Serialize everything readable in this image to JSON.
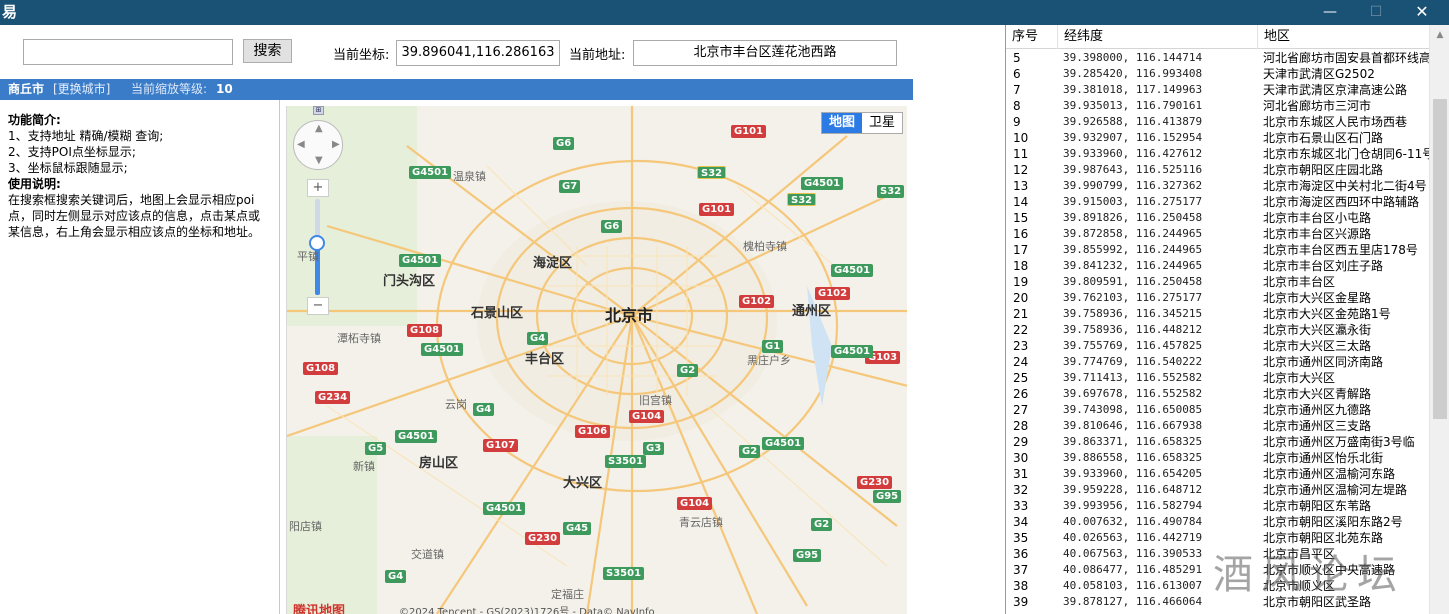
{
  "window": {
    "icon": "app-icon",
    "title": "",
    "controls": {
      "minimize": "—",
      "maximize": "☐",
      "close": "✕"
    }
  },
  "toolbar": {
    "search_value": "",
    "search_button": "搜索",
    "coord_label": "当前坐标:",
    "coord_value": "39.896041,116.286163",
    "address_label": "当前地址:",
    "address_value": "北京市丰台区莲花池西路"
  },
  "city_bar": {
    "city_name": "商丘市",
    "change_city": "[更换城市]",
    "zoom_label": "当前缩放等级:",
    "zoom_value": "10"
  },
  "info": {
    "features_title": "功能简介:",
    "features": [
      "1、支持地址 精确/模糊 查询;",
      "2、支持POI点坐标显示;",
      "3、坐标鼠标跟随显示;"
    ],
    "usage_title": "使用说明:",
    "usage_text": "在搜索框搜索关键词后，地图上会显示相应poi点，同时左侧显示对应该点的信息，点击某点或某信息，右上角会显示相应该点的坐标和地址。"
  },
  "map": {
    "map_type_buttons": [
      "地图",
      "卫星"
    ],
    "selected_type": "地图",
    "zoom_in": "+",
    "zoom_out": "−",
    "zoom_level_fraction": 0.45,
    "logo": "腾讯地图",
    "copyright": "©2024 Tencent - GS(2023)1726号 - Data© NavInfo",
    "city_label": "北京市",
    "districts": [
      "海淀区",
      "门头沟区",
      "石景山区",
      "丰台区",
      "通州区",
      "房山区",
      "大兴区"
    ],
    "towns": [
      "温泉镇",
      "槐柏寺镇",
      "潭柘寺镇",
      "云岗",
      "黑庄户乡",
      "旧宫镇",
      "新镇",
      "交道镇",
      "青云店镇",
      "定福庄",
      "平镇",
      "阳店镇"
    ],
    "shields": [
      "G6",
      "G7",
      "G6",
      "S32",
      "G4501",
      "G101",
      "G4501",
      "S32",
      "G4501",
      "G102",
      "G102",
      "G4501",
      "G103",
      "G108",
      "G4501",
      "G4",
      "G1",
      "G2",
      "G4501",
      "G4",
      "G107",
      "G106",
      "G104",
      "G3",
      "S3501",
      "G4501",
      "G2",
      "G4501",
      "G104",
      "G230",
      "G95",
      "G45",
      "G230",
      "G2",
      "S3501",
      "G95",
      "G4",
      "G5",
      "G108",
      "G234",
      "G101",
      "S32",
      "G4501"
    ]
  },
  "grid": {
    "headers": {
      "no": "序号",
      "coord": "经纬度",
      "region": "地区"
    },
    "rows": [
      {
        "no": "5",
        "coord": "39.398000, 116.144714",
        "region": "河北省廊坊市固安县首都环线高"
      },
      {
        "no": "6",
        "coord": "39.285420, 116.993408",
        "region": "天津市武清区G2502"
      },
      {
        "no": "7",
        "coord": "39.381018, 117.149963",
        "region": "天津市武清区京津高速公路"
      },
      {
        "no": "8",
        "coord": "39.935013, 116.790161",
        "region": "河北省廊坊市三河市"
      },
      {
        "no": "9",
        "coord": "39.926588, 116.413879",
        "region": "北京市东城区人民市场西巷"
      },
      {
        "no": "10",
        "coord": "39.932907, 116.152954",
        "region": "北京市石景山区石门路"
      },
      {
        "no": "11",
        "coord": "39.933960, 116.427612",
        "region": "北京市东城区北门仓胡同6-11号"
      },
      {
        "no": "12",
        "coord": "39.987643, 116.525116",
        "region": "北京市朝阳区庄园北路"
      },
      {
        "no": "13",
        "coord": "39.990799, 116.327362",
        "region": "北京市海淀区中关村北二街4号"
      },
      {
        "no": "14",
        "coord": "39.915003, 116.275177",
        "region": "北京市海淀区西四环中路辅路"
      },
      {
        "no": "15",
        "coord": "39.891826, 116.250458",
        "region": "北京市丰台区小屯路"
      },
      {
        "no": "16",
        "coord": "39.872858, 116.244965",
        "region": "北京市丰台区兴源路"
      },
      {
        "no": "17",
        "coord": "39.855992, 116.244965",
        "region": "北京市丰台区西五里店178号"
      },
      {
        "no": "18",
        "coord": "39.841232, 116.244965",
        "region": "北京市丰台区刘庄子路"
      },
      {
        "no": "19",
        "coord": "39.809591, 116.250458",
        "region": "北京市丰台区"
      },
      {
        "no": "20",
        "coord": "39.762103, 116.275177",
        "region": "北京市大兴区金星路"
      },
      {
        "no": "21",
        "coord": "39.758936, 116.345215",
        "region": "北京市大兴区金苑路1号"
      },
      {
        "no": "22",
        "coord": "39.758936, 116.448212",
        "region": "北京市大兴区瀛永街"
      },
      {
        "no": "23",
        "coord": "39.755769, 116.457825",
        "region": "北京市大兴区三太路"
      },
      {
        "no": "24",
        "coord": "39.774769, 116.540222",
        "region": "北京市通州区同济南路"
      },
      {
        "no": "25",
        "coord": "39.711413, 116.552582",
        "region": "北京市大兴区"
      },
      {
        "no": "26",
        "coord": "39.697678, 116.552582",
        "region": "北京市大兴区青解路"
      },
      {
        "no": "27",
        "coord": "39.743098, 116.650085",
        "region": "北京市通州区九德路"
      },
      {
        "no": "28",
        "coord": "39.810646, 116.667938",
        "region": "北京市通州区三支路"
      },
      {
        "no": "29",
        "coord": "39.863371, 116.658325",
        "region": "北京市通州区万盛南街3号临"
      },
      {
        "no": "30",
        "coord": "39.886558, 116.658325",
        "region": "北京市通州区怡乐北街"
      },
      {
        "no": "31",
        "coord": "39.933960, 116.654205",
        "region": "北京市通州区温榆河东路"
      },
      {
        "no": "32",
        "coord": "39.959228, 116.648712",
        "region": "北京市通州区温榆河左堤路"
      },
      {
        "no": "33",
        "coord": "39.993956, 116.582794",
        "region": "北京市朝阳区东苇路"
      },
      {
        "no": "34",
        "coord": "40.007632, 116.490784",
        "region": "北京市朝阳区溪阳东路2号"
      },
      {
        "no": "35",
        "coord": "40.026563, 116.442719",
        "region": "北京市朝阳区北苑东路"
      },
      {
        "no": "36",
        "coord": "40.067563, 116.390533",
        "region": "北京市昌平区"
      },
      {
        "no": "37",
        "coord": "40.086477, 116.485291",
        "region": "北京市顺义区中央高速路"
      },
      {
        "no": "38",
        "coord": "40.058103, 116.613007",
        "region": "北京市顺义区"
      },
      {
        "no": "39",
        "coord": "39.878127, 116.466064",
        "region": "北京市朝阳区武圣路"
      }
    ]
  },
  "watermark": "酒风论坛"
}
